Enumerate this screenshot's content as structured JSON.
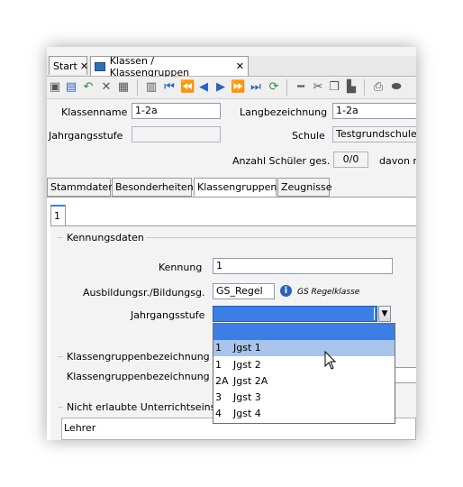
{
  "tabs": {
    "start": "Start",
    "klassen": "Klassen / Klassengruppen",
    "close": "✕"
  },
  "form": {
    "klassenname_label": "Klassenname",
    "klassenname_value": "1-2a",
    "langbezeichnung_label": "Langbezeichnung",
    "langbezeichnung_value": "1-2a",
    "jahrgangsstufe_label": "Jahrgangsstufe",
    "jahrgangsstufe_value": "",
    "schule_label": "Schule",
    "schule_value": "Testgrundschule",
    "anzahl_label": "Anzahl Schüler ges.",
    "anzahl_value": "0/0",
    "davon_label": "davon m"
  },
  "subtabs": [
    "Stammdaten",
    "Besonderheiten",
    "Klassengruppen",
    "Zeugnisse"
  ],
  "inner_tab": "1",
  "kennungsdaten": {
    "group_label": "Kennungsdaten",
    "kennung_label": "Kennung",
    "kennung_value": "1",
    "ausbildung_label": "Ausbildungsr./Bildungsg.",
    "ausbildung_value": "GS_Regel",
    "ausbildung_hint": "GS Regelklasse",
    "jgst_label": "Jahrgangsstufe",
    "jgst_value": ""
  },
  "bezeichnung": {
    "group_label": "Klassengruppenbezeichnung fü",
    "field_label": "Klassengruppenbezeichnung"
  },
  "nicht_erlaubt": {
    "group_label": "Nicht erlaubte Unterrichtseinsä",
    "column_header": "Lehrer"
  },
  "dropdown": {
    "options": [
      {
        "code": "",
        "text": ""
      },
      {
        "code": "1",
        "text": "Jgst 1"
      },
      {
        "code": "1",
        "text": "Jgst 2"
      },
      {
        "code": "2A",
        "text": "Jgst 2A"
      },
      {
        "code": "3",
        "text": "Jgst 3"
      },
      {
        "code": "4",
        "text": "Jgst 4"
      }
    ],
    "selected_index": 0,
    "hover_index": 1
  },
  "colors": {
    "selected": "#3a7ee6",
    "hover": "#a9c4ea",
    "accent": "#2a62b8"
  },
  "icons": [
    "save-icon",
    "undo-icon",
    "delete-icon",
    "first-icon",
    "prev-icon",
    "next-icon",
    "last-icon",
    "refresh-icon",
    "cut-icon",
    "copy-icon",
    "paste-icon",
    "print-icon",
    "info-icon",
    "mouse-cursor-icon"
  ]
}
